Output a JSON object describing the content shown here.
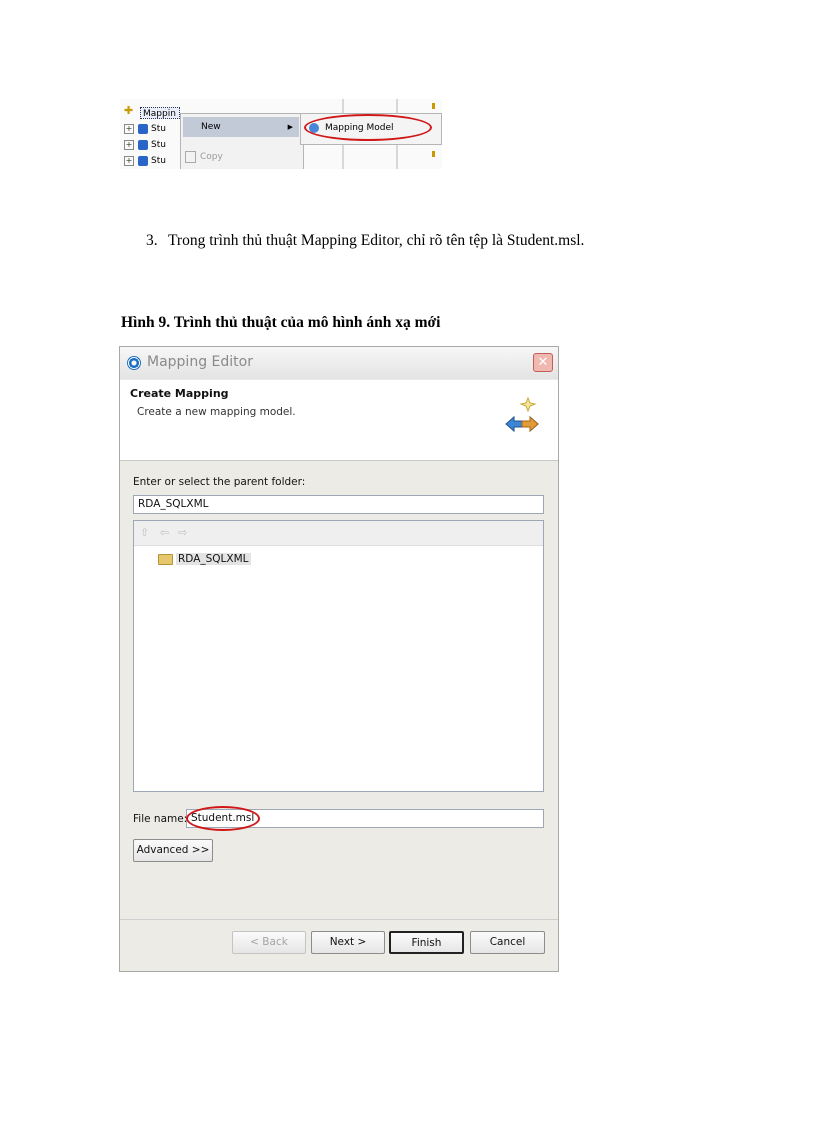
{
  "context_menu_shot": {
    "tree_selected": "Mappin",
    "tree_rows": [
      "Stu",
      "Stu",
      "Stu"
    ],
    "menu_new": "New",
    "menu_copy": "Copy",
    "submenu_item": "Mapping Model"
  },
  "step": {
    "number": "3.",
    "text": "Trong trình thủ thuật Mapping Editor, chỉ rõ tên tệp là Student.msl."
  },
  "caption": "Hình 9. Trình thủ thuật của mô hình ánh xạ mới",
  "dialog": {
    "title": "Mapping Editor",
    "banner_title": "Create Mapping",
    "banner_desc": "Create a new mapping model.",
    "folder_label": "Enter or select the parent folder:",
    "folder_value": "RDA_SQLXML",
    "tree_item": "RDA_SQLXML",
    "file_name_label": "File name:",
    "file_name_value": "Student.msl",
    "advanced_button": "Advanced >>",
    "back_button": "< Back",
    "next_button": "Next >",
    "finish_button": "Finish",
    "cancel_button": "Cancel"
  },
  "icons": {
    "app": "mapping-editor-icon",
    "close": "close-icon",
    "banner": "bidirectional-arrow-icon",
    "folder": "folder-icon"
  },
  "colors": {
    "highlight_oval": "#d01818",
    "dialog_bg": "#ecebe6"
  }
}
